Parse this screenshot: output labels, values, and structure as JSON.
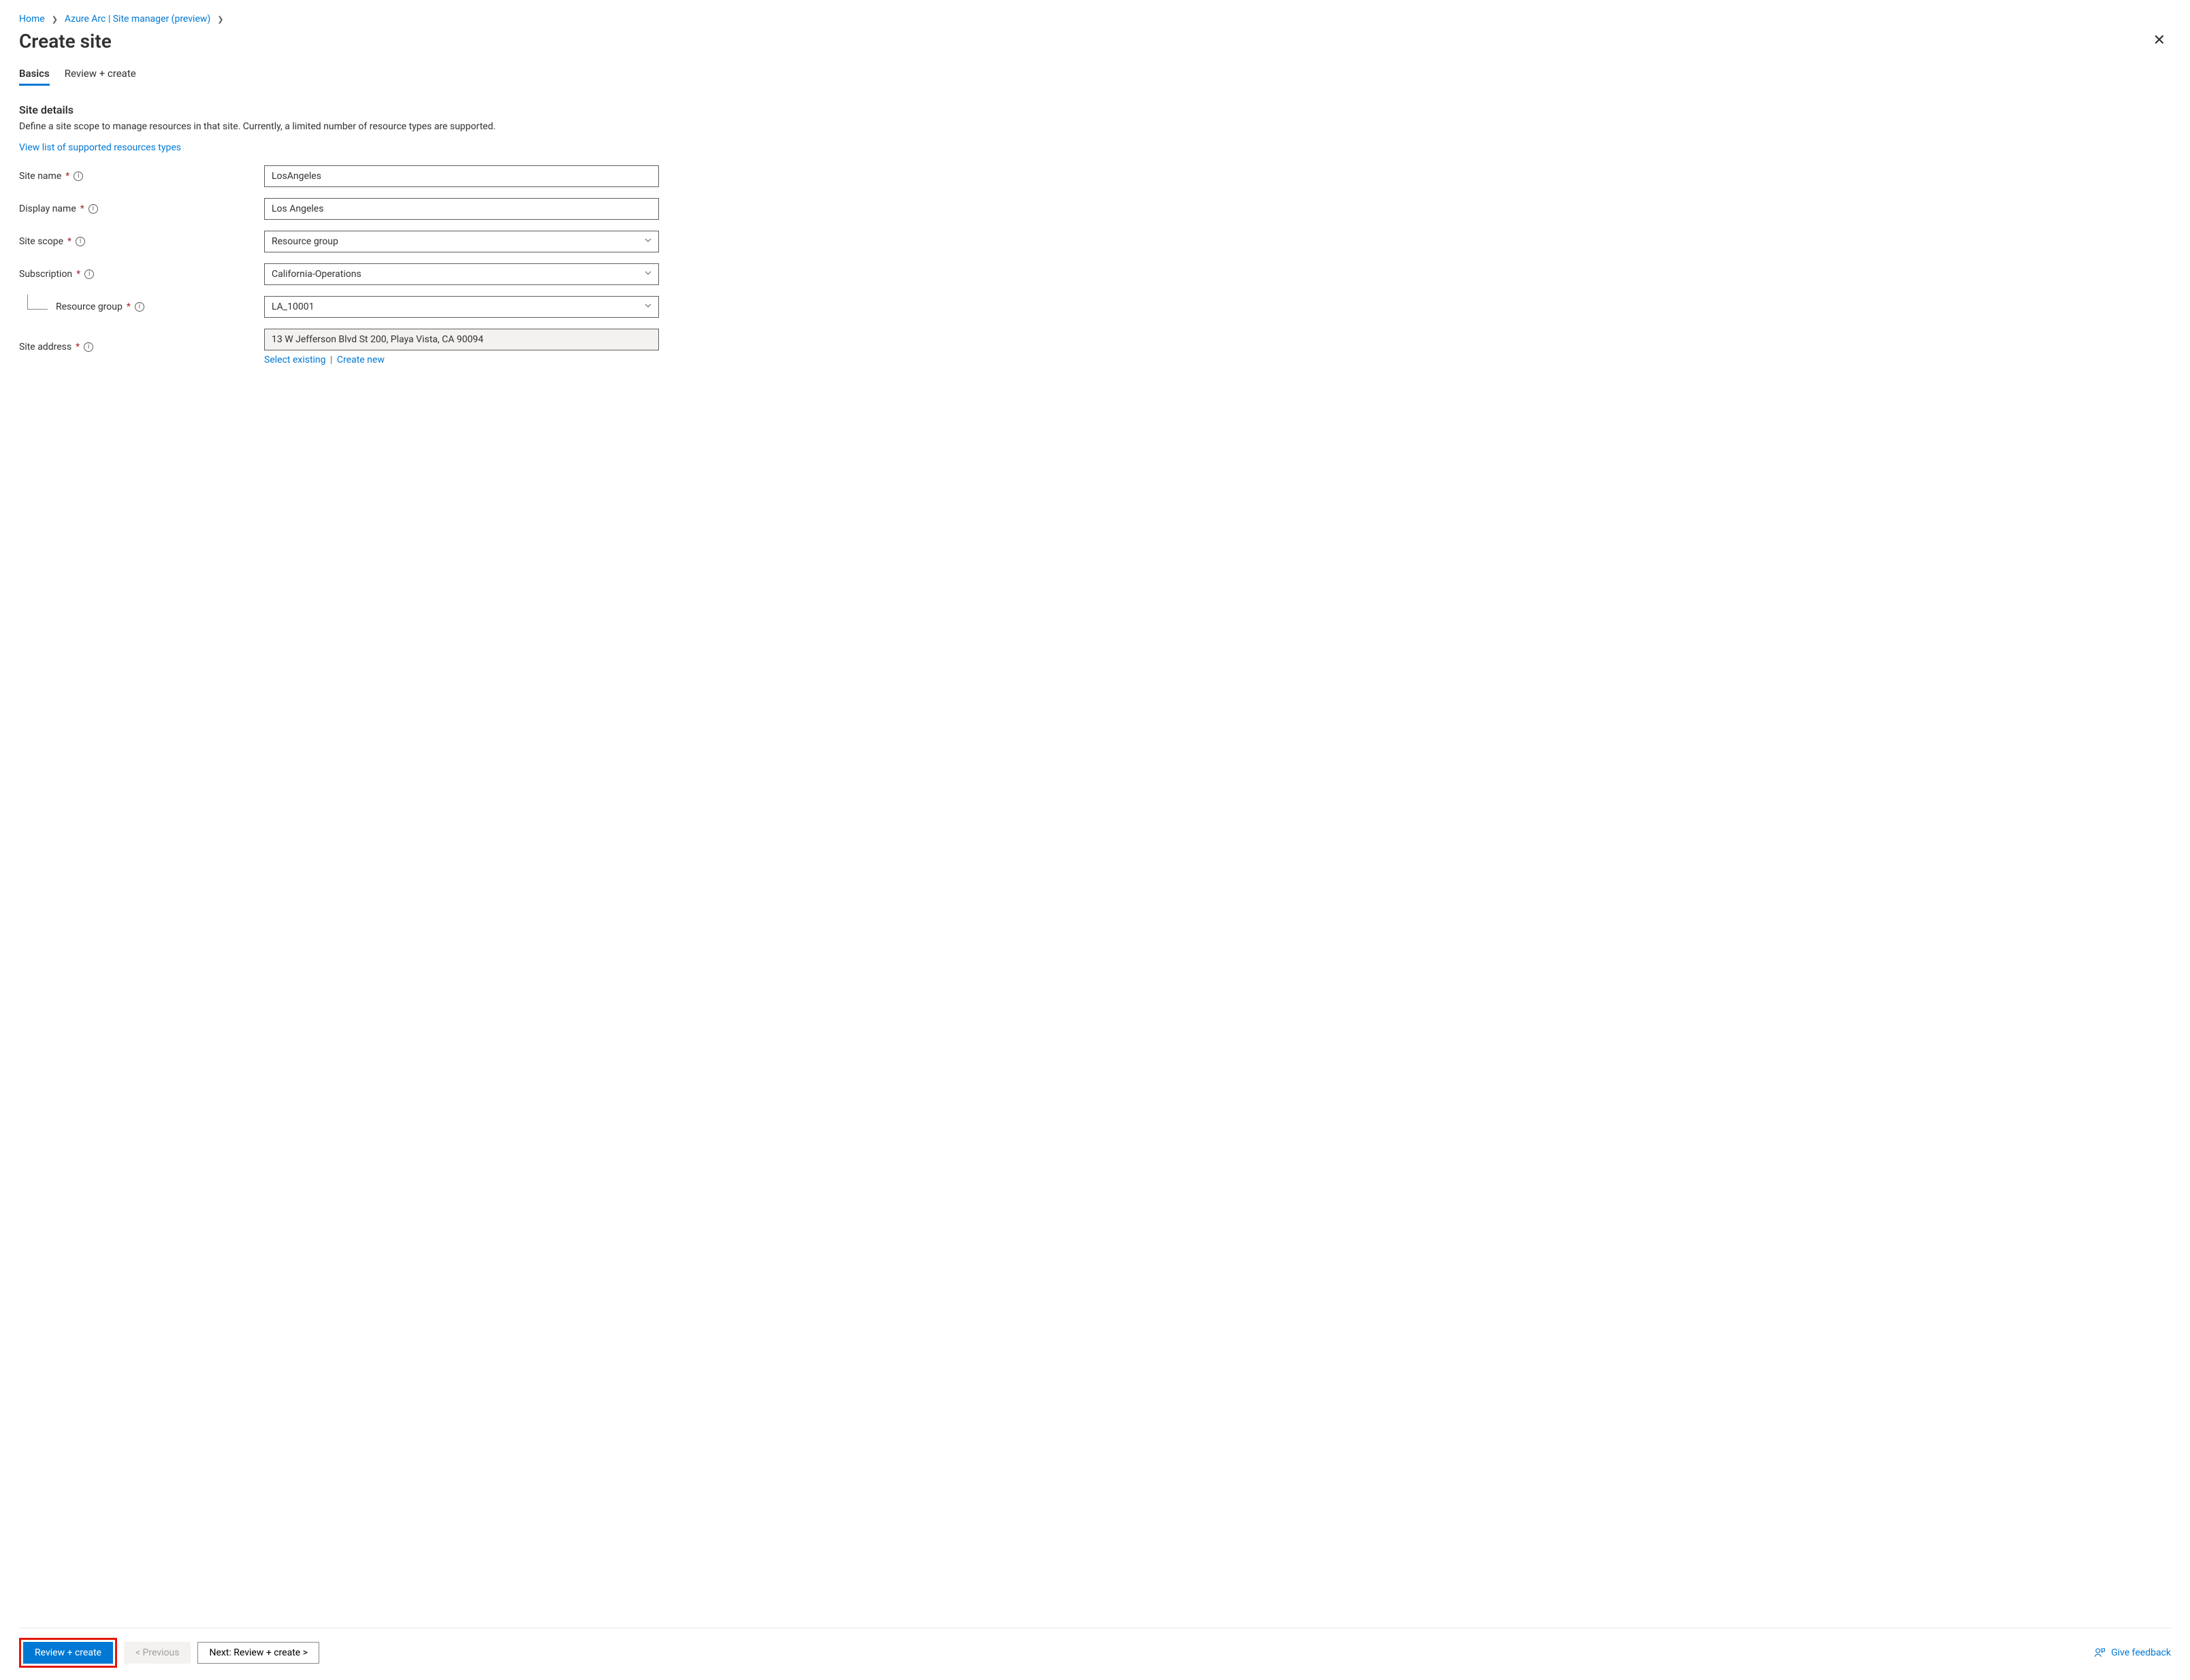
{
  "breadcrumb": {
    "home": "Home",
    "sitemanager": "Azure Arc | Site manager (preview)"
  },
  "header": {
    "title": "Create site"
  },
  "tabs": {
    "basics": "Basics",
    "review": "Review + create"
  },
  "section": {
    "title": "Site details",
    "description": "Define a site scope to manage resources in that site. Currently, a limited number of resource types are supported.",
    "support_link": "View list of supported resources types"
  },
  "form": {
    "site_name_label": "Site name",
    "site_name_value": "LosAngeles",
    "display_name_label": "Display name",
    "display_name_value": "Los Angeles",
    "site_scope_label": "Site scope",
    "site_scope_value": "Resource group",
    "subscription_label": "Subscription",
    "subscription_value": "California-Operations",
    "resource_group_label": "Resource group",
    "resource_group_value": "LA_10001",
    "site_address_label": "Site address",
    "site_address_value": "13 W Jefferson Blvd St 200, Playa Vista, CA 90094",
    "select_existing": "Select existing",
    "create_new": "Create new"
  },
  "footer": {
    "review_create": "Review + create",
    "previous": "< Previous",
    "next": "Next: Review + create >",
    "feedback": "Give feedback"
  }
}
